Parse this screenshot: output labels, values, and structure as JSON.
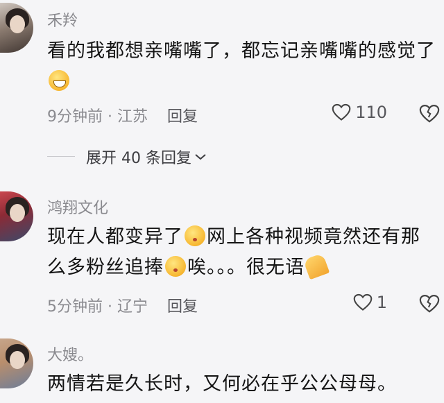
{
  "comments": [
    {
      "username": "禾羚",
      "text_before": "看的我都想亲嘴嘴了，都忘记亲嘴嘴的感觉了",
      "emoji": "grinning-sweat-emoji",
      "text_after": "",
      "time": "9分钟前",
      "location": "江苏",
      "reply_label": "回复",
      "likes": "110"
    },
    {
      "username": "鸿翔文化",
      "text_before": "现在人都变异了",
      "emoji": "pouting-face-emoji",
      "text_middle": "网上各种视频竟然还有那么多粉丝追捧",
      "emoji2": "pouting-face-emoji",
      "text_after": "唉。。。很无语",
      "emoji3": "folded-hands-emoji",
      "time": "5分钟前",
      "location": "辽宁",
      "reply_label": "回复",
      "likes": "1"
    },
    {
      "username": "大嫂。",
      "text_before": "两情若是久长时，又何必在乎公公母母。",
      "time": "",
      "location": "",
      "reply_label": "",
      "likes": ""
    }
  ],
  "expand_replies": "展开 40 条回复",
  "separator": " · ",
  "colors": {
    "background": "#f5f5f7",
    "username": "#8a8a8f",
    "content": "#141414",
    "meta": "#8a8a8f"
  },
  "icons": {
    "like": "heart-outline-icon",
    "dislike": "broken-heart-icon",
    "expand": "chevron-down-icon"
  }
}
